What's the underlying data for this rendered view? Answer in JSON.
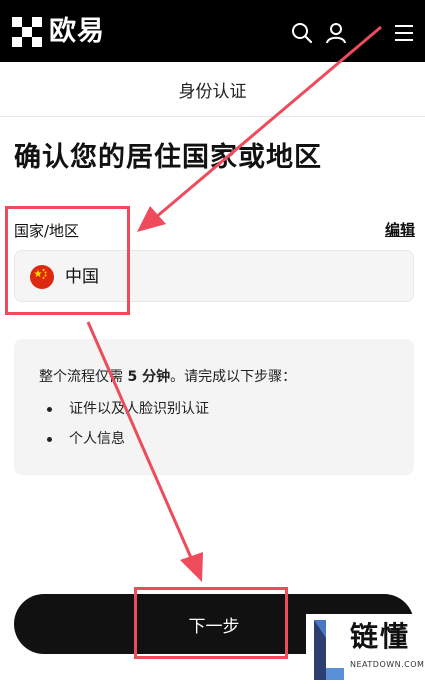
{
  "header": {
    "logo_text": "欧易",
    "search_icon": "search-icon",
    "user_icon": "user-icon",
    "menu_icon": "menu-icon"
  },
  "subheader": {
    "title": "身份认证"
  },
  "main": {
    "heading": "确认您的居住国家或地区",
    "country_label": "国家/地区",
    "edit_label": "编辑",
    "country_value": "中国",
    "flag_icon": "china-flag-icon",
    "info_prefix": "整个流程仅需 ",
    "info_duration": "5 分钟",
    "info_suffix": "。请完成以下步骤：",
    "steps": [
      "证件以及人脸识别认证",
      "个人信息"
    ],
    "next_button": "下一步"
  },
  "annotation": {
    "highlight_color": "#ee4b5c"
  },
  "watermark": {
    "text": "链懂",
    "url": "NEATDOWN.COM"
  }
}
